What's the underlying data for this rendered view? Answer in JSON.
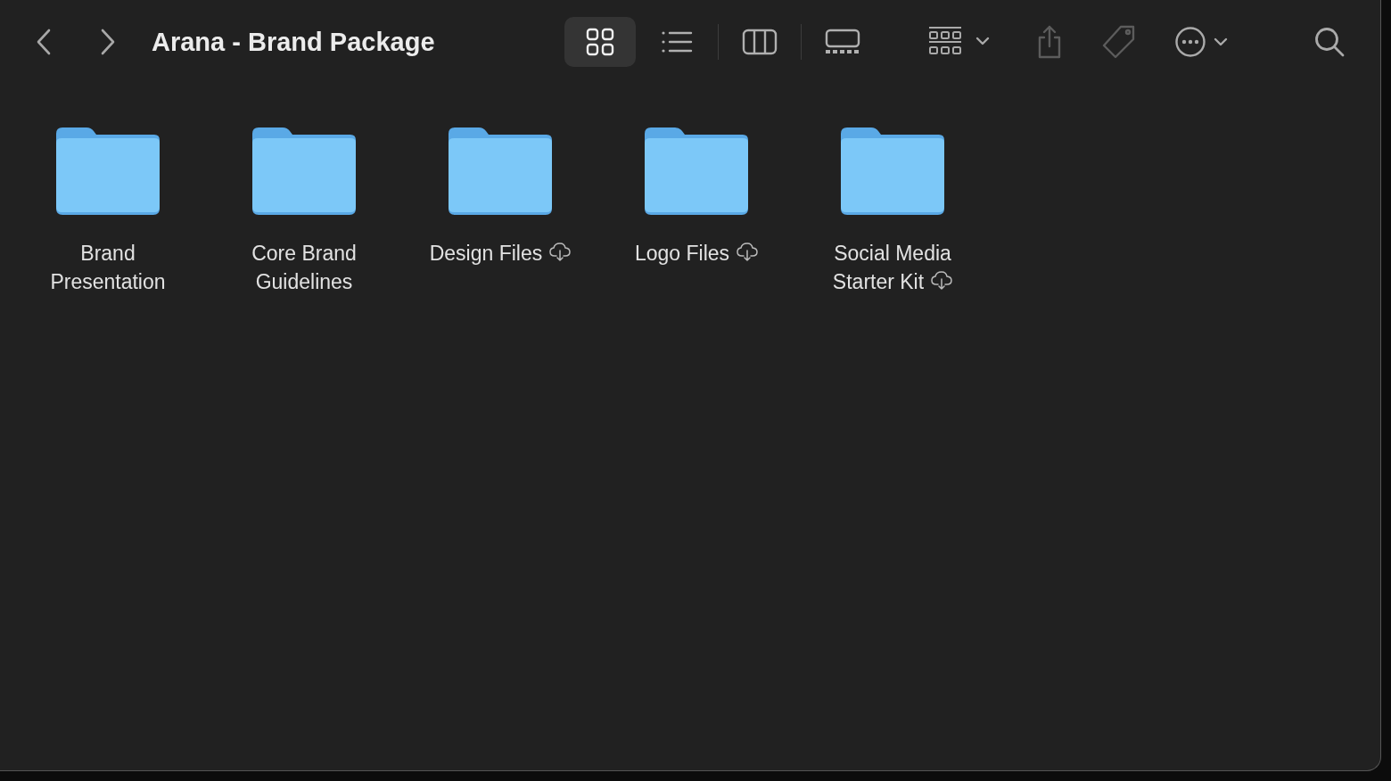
{
  "window": {
    "title": "Arana - Brand Package"
  },
  "view_modes": [
    {
      "kind": "icons",
      "selected": true
    },
    {
      "kind": "list",
      "selected": false
    },
    {
      "kind": "columns",
      "selected": false
    },
    {
      "kind": "gallery",
      "selected": false
    }
  ],
  "folders": [
    {
      "name": "Brand Presentation",
      "in_cloud": false
    },
    {
      "name": "Core Brand Guidelines",
      "in_cloud": false
    },
    {
      "name": "Design Files",
      "in_cloud": true
    },
    {
      "name": "Logo Files",
      "in_cloud": true
    },
    {
      "name": "Social Media Starter Kit",
      "in_cloud": true
    }
  ]
}
